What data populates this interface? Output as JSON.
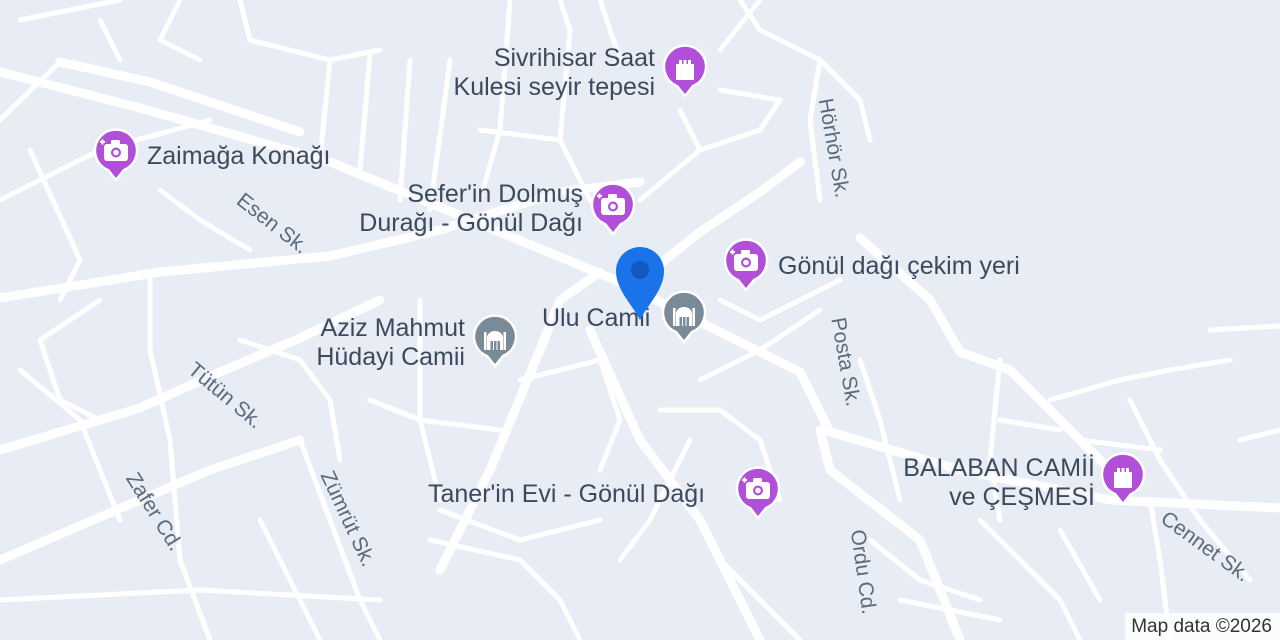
{
  "map": {
    "colors": {
      "background": "#e8ecf4",
      "road": "#ffffff",
      "poi_attraction": "#b14fd8",
      "poi_religious": "#7b8a97",
      "location_pin": "#1a73e8"
    },
    "streets": {
      "hörhör": "Hörhör Sk.",
      "esen": "Esen Sk.",
      "posta": "Posta Sk.",
      "tütün": "Tütün Sk.",
      "zafer": "Zafer Cd.",
      "zümrüt": "Zümrüt Sk.",
      "ordu": "Ordu Cd.",
      "cennet": "Cennet Sk."
    },
    "pois": {
      "saat_kulesi": {
        "line1": "Sivrihisar Saat",
        "line2": "Kulesi seyir tepesi",
        "icon": "castle-icon"
      },
      "zaimaga": {
        "label": "Zaimağa Konağı",
        "icon": "camera-icon"
      },
      "sefer": {
        "line1": "Sefer'in Dolmuş",
        "line2": "Durağı - Gönül Dağı",
        "icon": "camera-icon"
      },
      "gonul_dagi": {
        "label": "Gönül dağı çekim yeri",
        "icon": "camera-icon"
      },
      "aziz_mahmut": {
        "line1": "Aziz Mahmut",
        "line2": "Hüdayi Camii",
        "icon": "mosque-icon"
      },
      "ulu_camii": {
        "label": "Ulu Camii",
        "icon": "mosque-icon"
      },
      "taner": {
        "label": "Taner'in Evi - Gönül Dağı",
        "icon": "camera-icon"
      },
      "balaban": {
        "line1": "BALABAN CAMİİ",
        "line2": "ve ÇEŞMESİ",
        "icon": "castle-icon"
      }
    },
    "attribution": "Map data ©2026"
  }
}
